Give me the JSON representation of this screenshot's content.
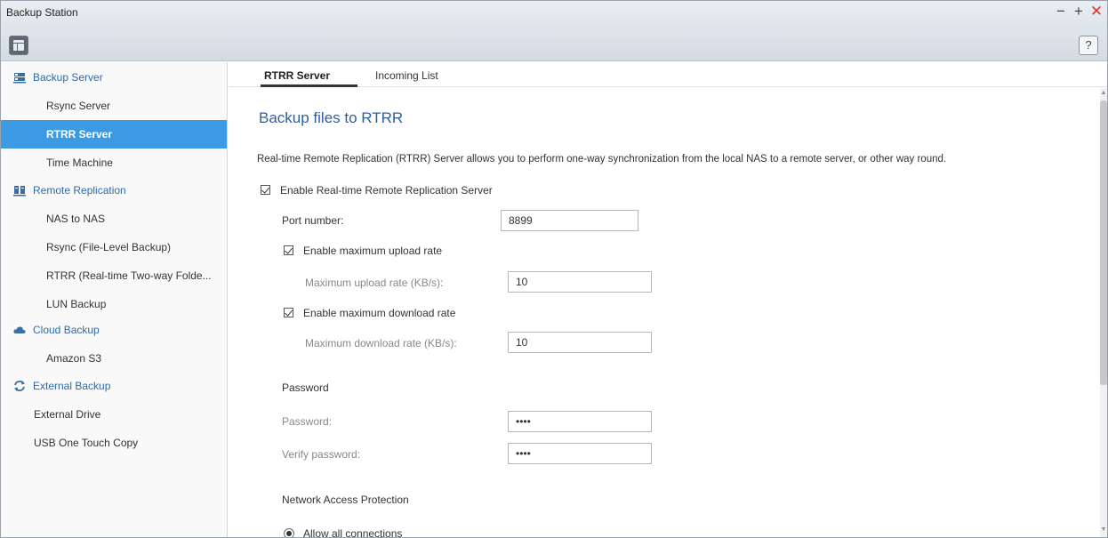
{
  "window": {
    "title": "Backup Station"
  },
  "controls": {
    "minimize": "−",
    "maximize": "+",
    "close": "✕",
    "help": "?"
  },
  "sidebar": {
    "backup_server": {
      "label": "Backup Server",
      "items": [
        "Rsync Server",
        "RTRR Server",
        "Time Machine"
      ]
    },
    "remote_replication": {
      "label": "Remote Replication",
      "items": [
        "NAS to NAS",
        "Rsync (File-Level Backup)",
        "RTRR (Real-time Two-way Folde...",
        "LUN Backup"
      ]
    },
    "cloud_backup": {
      "label": "Cloud Backup",
      "items": [
        "Amazon S3"
      ]
    },
    "external_backup": {
      "label": "External Backup",
      "items": [
        "External Drive",
        "USB One Touch Copy"
      ]
    },
    "active_item": "RTRR Server"
  },
  "tabs": [
    "RTRR Server",
    "Incoming List"
  ],
  "main": {
    "heading": "Backup files to RTRR",
    "description": "Real-time Remote Replication (RTRR) Server allows you to perform one-way synchronization from the local NAS to a remote server, or other way round.",
    "enable_server_label": "Enable Real-time Remote Replication Server",
    "port_label": "Port number:",
    "port_value": "8899",
    "enable_upload_label": "Enable maximum upload rate",
    "upload_rate_label": "Maximum upload rate (KB/s):",
    "upload_rate_value": "10",
    "enable_download_label": "Enable maximum download rate",
    "download_rate_label": "Maximum download rate (KB/s):",
    "download_rate_value": "10",
    "password_section": "Password",
    "password_label": "Password:",
    "password_value": "••••",
    "verify_label": "Verify password:",
    "verify_value": "••••",
    "network_section": "Network Access Protection",
    "allow_all_label": "Allow all connections"
  },
  "colors": {
    "accent": "#3b9ae1",
    "heading": "#2d5fa0",
    "group": "#2e6aa8",
    "close": "#d33333"
  },
  "icons": [
    "menu-icon",
    "help-icon",
    "server-icon",
    "replication-icon",
    "cloud-icon",
    "sync-icon"
  ]
}
